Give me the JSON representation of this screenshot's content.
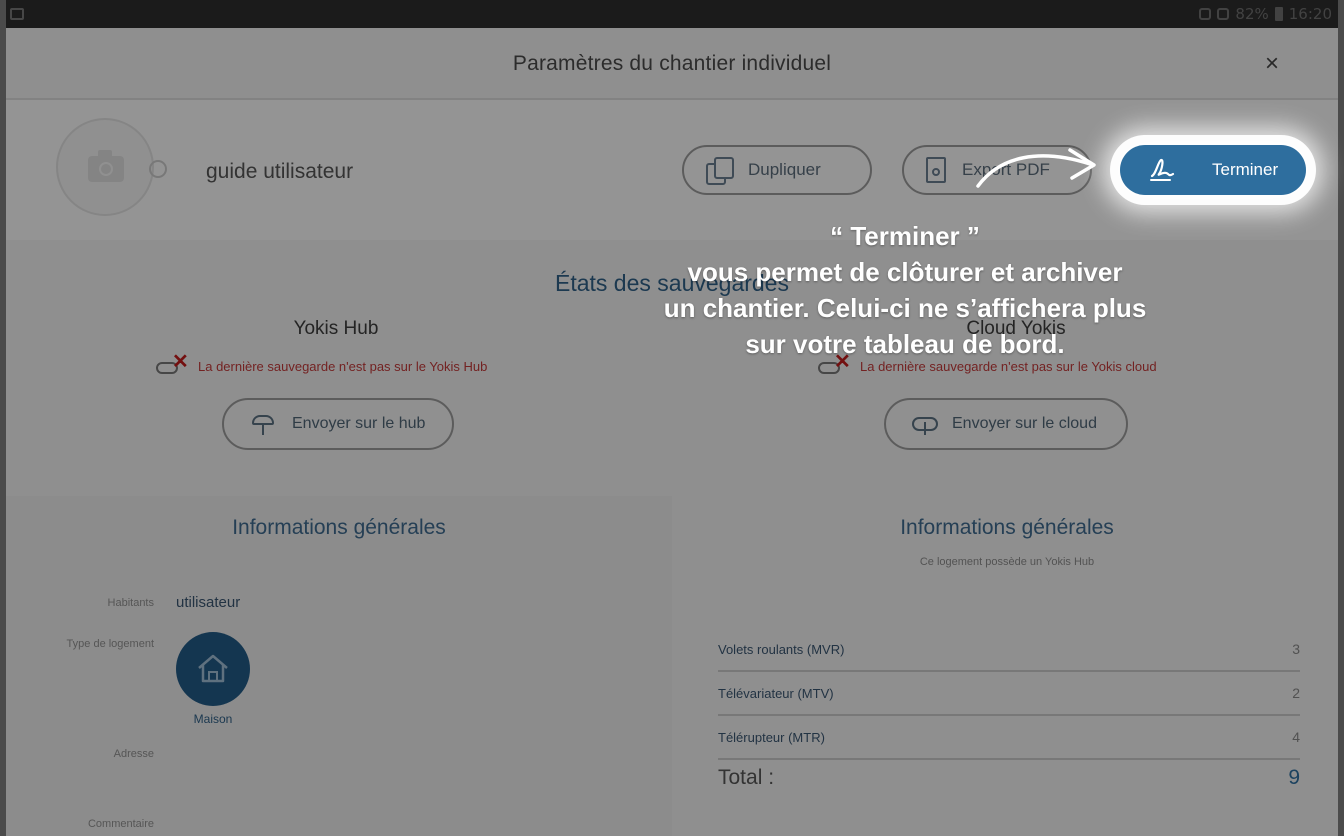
{
  "status_bar": {
    "battery": "82%",
    "time": "16:20"
  },
  "header": {
    "title": "Paramètres du chantier individuel",
    "close": "×"
  },
  "project": {
    "name": "guide utilisateur",
    "buttons": {
      "duplicate": "Dupliquer",
      "export": "Export PDF",
      "finish": "Terminer"
    }
  },
  "saves": {
    "title": "États des sauvegardes",
    "hub": {
      "title": "Yokis Hub",
      "warning": "La dernière sauvegarde n'est pas sur le Yokis Hub",
      "button": "Envoyer sur le hub"
    },
    "cloud": {
      "title": "Cloud Yokis",
      "warning": "La dernière sauvegarde n'est pas sur le Yokis cloud",
      "button": "Envoyer sur le cloud"
    }
  },
  "info_left": {
    "title": "Informations générales",
    "fields": {
      "inhabitants_label": "Habitants",
      "inhabitants_value": "utilisateur",
      "type_label": "Type de logement",
      "type_value": "Maison",
      "address_label": "Adresse",
      "comment_label": "Commentaire"
    }
  },
  "info_right": {
    "title": "Informations générales",
    "note": "Ce logement possède un Yokis Hub",
    "rows": [
      {
        "label": "Volets roulants (MVR)",
        "count": "3"
      },
      {
        "label": "Télévariateur (MTV)",
        "count": "2"
      },
      {
        "label": "Télérupteur (MTR)",
        "count": "4"
      }
    ],
    "total_label": "Total :",
    "total_value": "9"
  },
  "annotation": {
    "lines": [
      "“ Terminer ”",
      "vous permet de clôturer et archiver",
      "un chantier. Celui-ci ne s’affichera plus",
      "sur votre tableau de bord."
    ]
  },
  "colors": {
    "accent": "#2e6e9e",
    "warning": "#c03a3a",
    "title_blue": "#2f5f86"
  },
  "icons": [
    "camera-icon",
    "edit-icon",
    "copy-icon",
    "pdf-icon",
    "signature-icon",
    "hub-icon",
    "cloud-upload-icon",
    "house-icon",
    "close-icon",
    "battery-icon"
  ]
}
